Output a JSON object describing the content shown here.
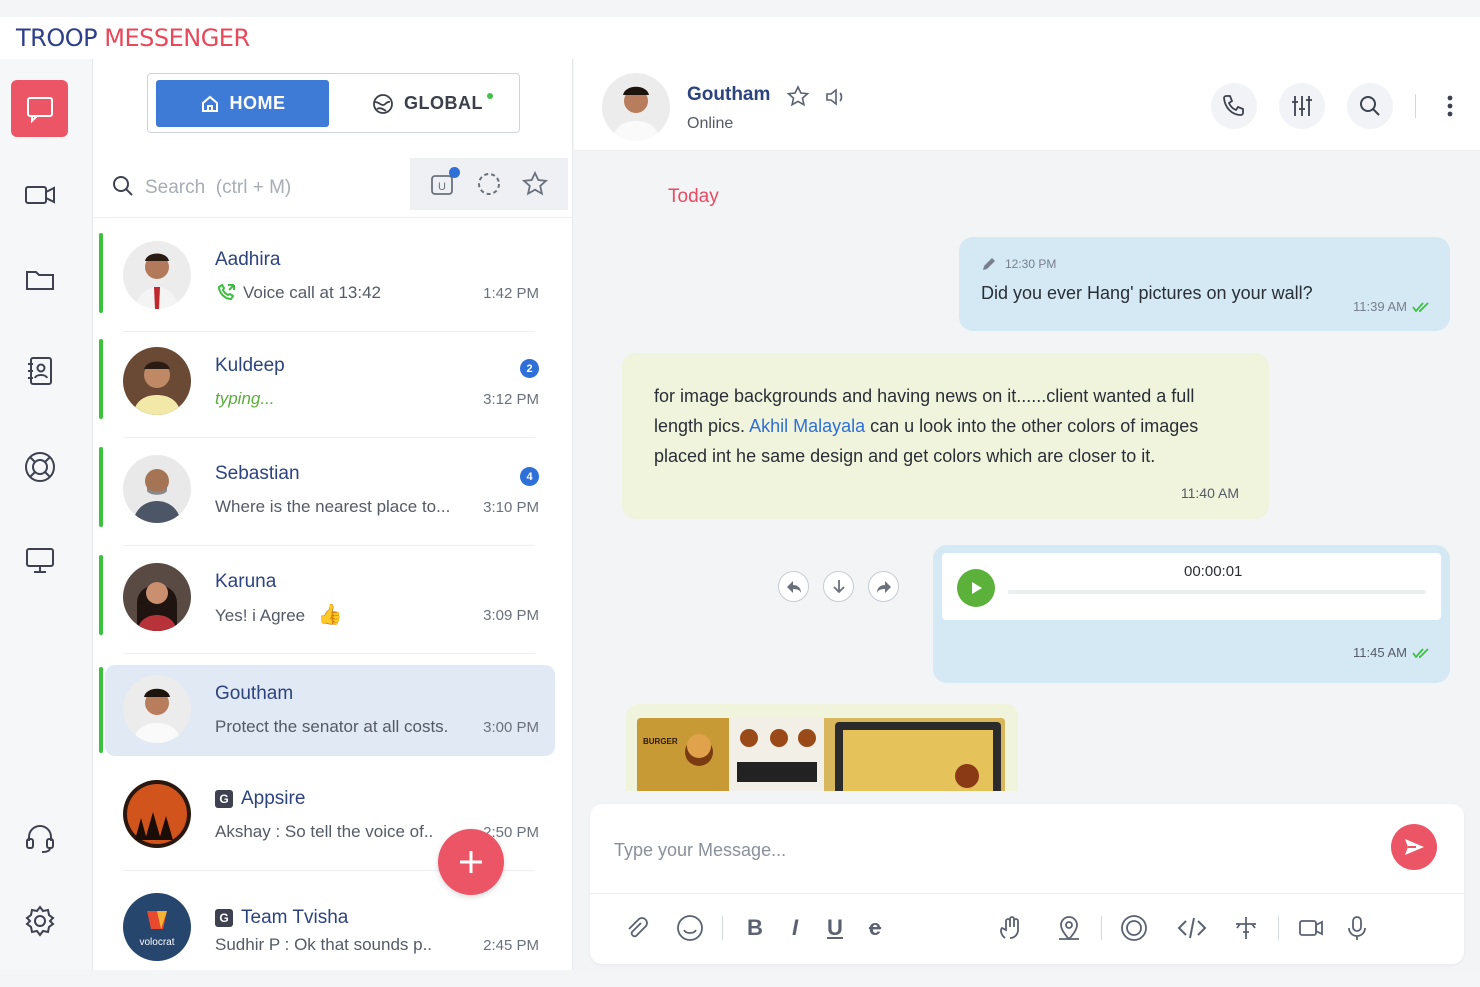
{
  "app": {
    "brand_part1": "TROOP",
    "brand_part2": "MESSENGER",
    "colors": {
      "accent": "#ec5566",
      "primary": "#3d7bd6",
      "online": "#3cc13f",
      "mention": "#2f6fd8"
    }
  },
  "rail": {
    "items": [
      {
        "name": "chat",
        "icon": "chat-bubble-icon",
        "active": true
      },
      {
        "name": "video",
        "icon": "video-camera-icon",
        "active": false
      },
      {
        "name": "files",
        "icon": "folder-icon",
        "active": false
      },
      {
        "name": "contacts",
        "icon": "contact-book-icon",
        "active": false
      },
      {
        "name": "lifebuoy",
        "icon": "lifebuoy-icon",
        "active": false
      },
      {
        "name": "screen",
        "icon": "monitor-icon",
        "active": false
      },
      {
        "name": "support",
        "icon": "headset-icon",
        "active": false
      },
      {
        "name": "settings",
        "icon": "gear-icon",
        "active": false
      }
    ]
  },
  "segment": {
    "home_label": "HOME",
    "global_label": "GLOBAL"
  },
  "search": {
    "placeholder": "Search  (ctrl + M)"
  },
  "chats": [
    {
      "name": "Aadhira",
      "preview": "Voice call at 13:42",
      "time": "1:42 PM",
      "badge": "",
      "type": "call"
    },
    {
      "name": "Kuldeep",
      "preview": "typing...",
      "time": "3:12 PM",
      "badge": "2",
      "type": "typing"
    },
    {
      "name": "Sebastian",
      "preview": "Where is the nearest place to...",
      "time": "3:10 PM",
      "badge": "4",
      "type": "text"
    },
    {
      "name": "Karuna",
      "preview": "Yes! i Agree",
      "time": "3:09 PM",
      "badge": "",
      "type": "emoji"
    },
    {
      "name": "Goutham",
      "preview": "Protect the senator at all costs.",
      "time": "3:00 PM",
      "badge": "",
      "type": "text",
      "selected": true
    },
    {
      "name": "Appsire",
      "preview": "Akshay  : So tell the voice of..",
      "time": "2:50 PM",
      "badge": "",
      "type": "group"
    },
    {
      "name": "Team Tvisha",
      "preview": "Sudhir P : Ok that sounds p..",
      "time": "2:45 PM",
      "badge": "",
      "type": "group",
      "avatar_text": "volocrat"
    }
  ],
  "header": {
    "name": "Goutham",
    "status": "Online"
  },
  "conversation": {
    "day_label": "Today",
    "msg1": {
      "edited_time": "12:30 PM",
      "text": "Did you ever Hang' pictures on your wall?",
      "time": "11:39 AM"
    },
    "msg2": {
      "text_before": "for image backgrounds and having news on it......client wanted a full length pics. ",
      "mention": "Akhil Malayala",
      "text_after": " can u look into the other colors of images placed int he same design and get colors which are closer to it.",
      "time": "11:40 AM"
    },
    "msg3": {
      "duration": "00:00:01",
      "time": "11:45 AM"
    },
    "msg4": {
      "thumb_label": "BURGER"
    }
  },
  "composer": {
    "placeholder": "Type your Message..."
  }
}
